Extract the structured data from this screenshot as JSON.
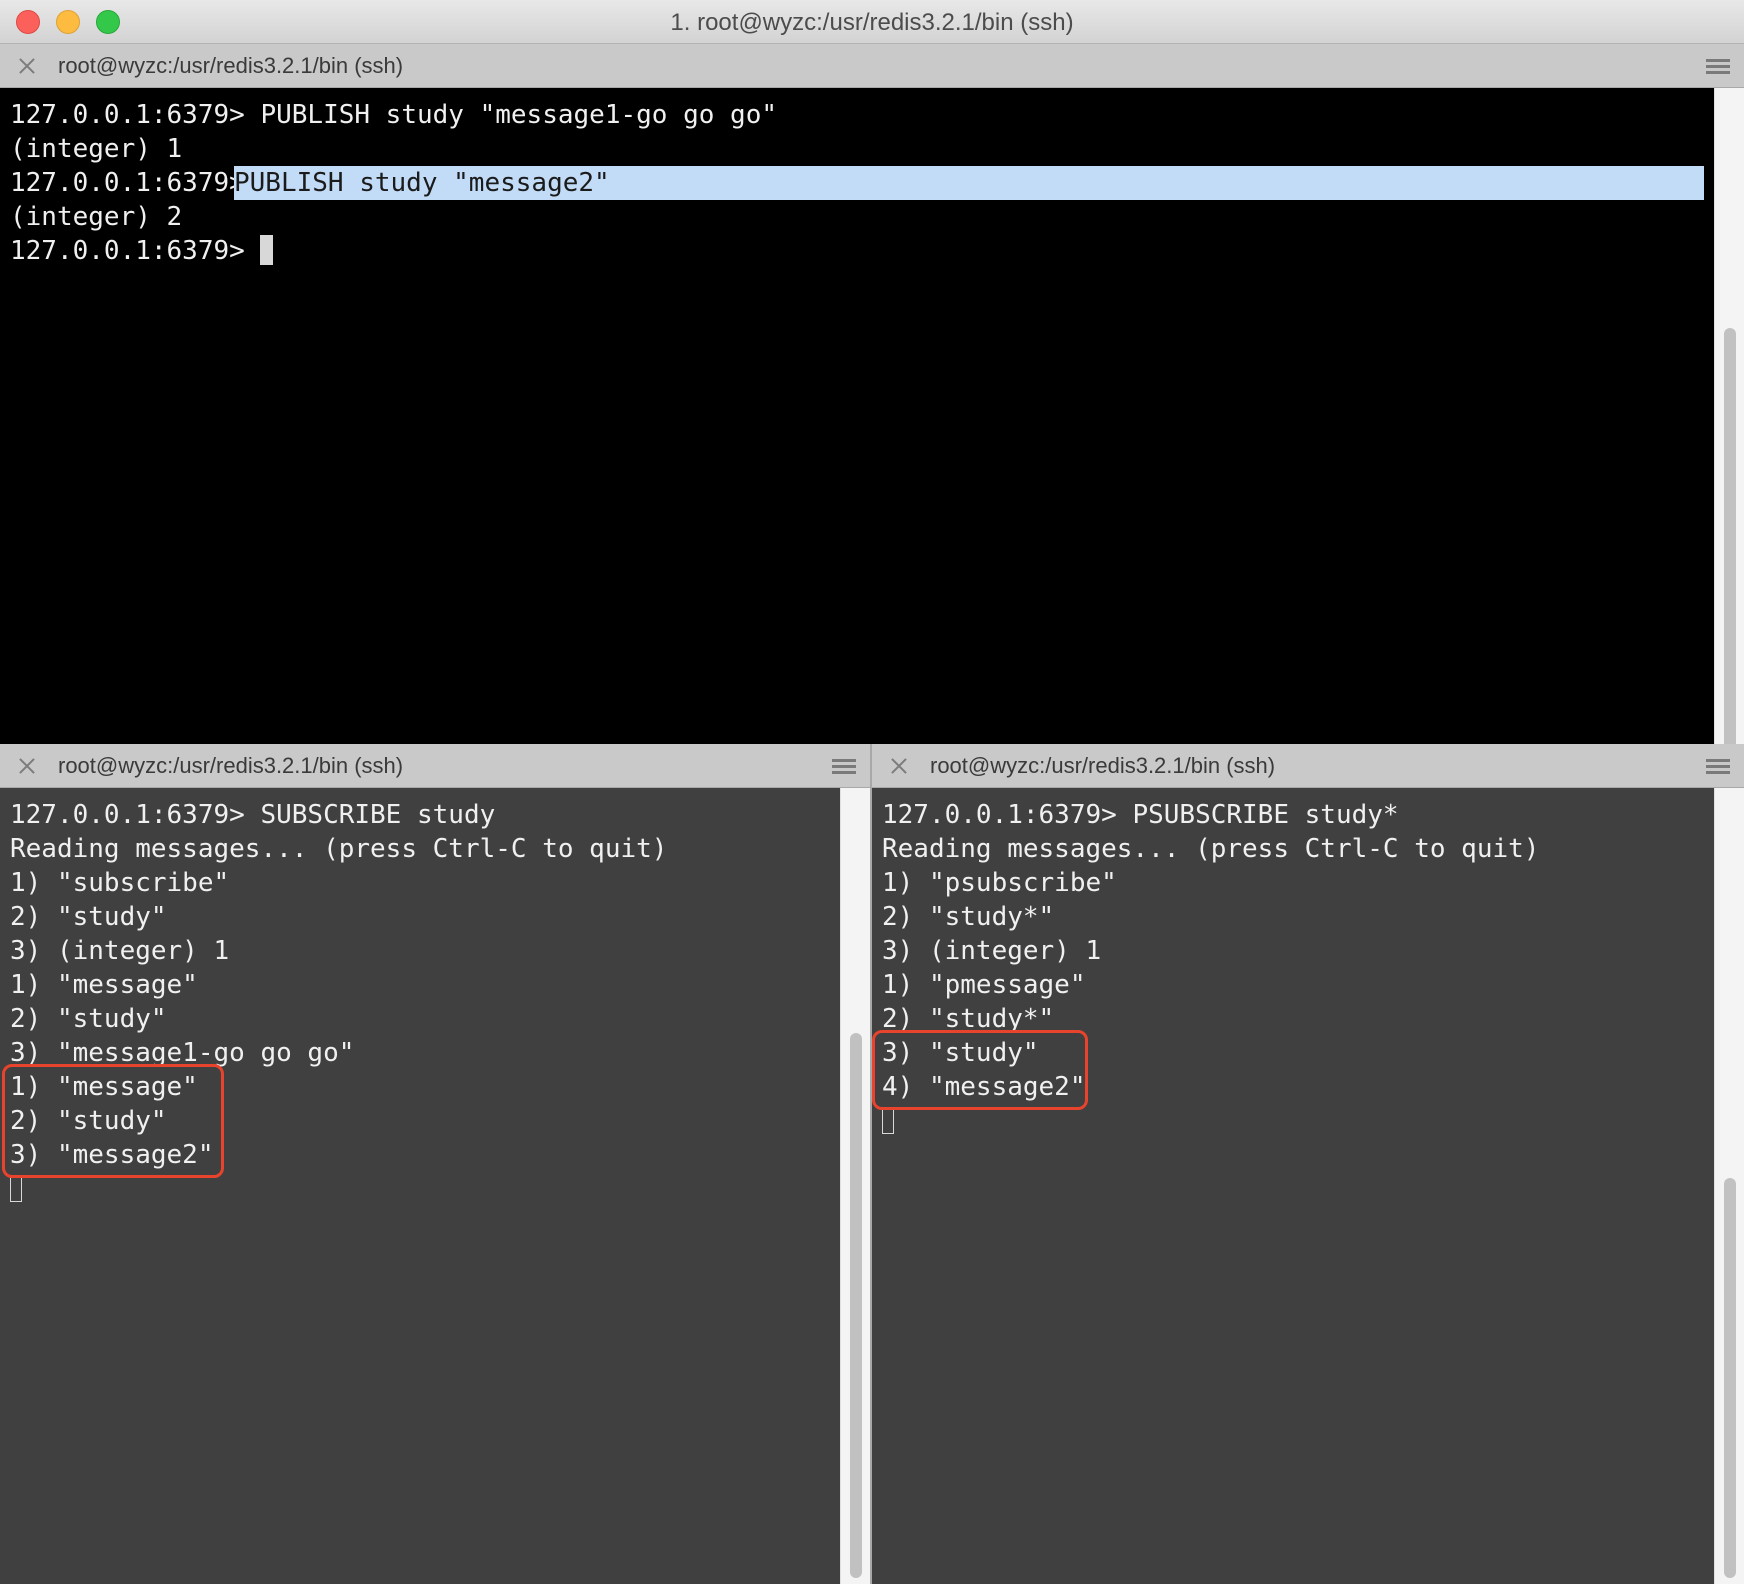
{
  "window": {
    "title": "1. root@wyzc:/usr/redis3.2.1/bin (ssh)"
  },
  "panes": {
    "top": {
      "title": "root@wyzc:/usr/redis3.2.1/bin (ssh)",
      "lines": [
        {
          "prompt": "127.0.0.1:6379> ",
          "text": "PUBLISH study \"message1-go go go\""
        },
        {
          "prompt": "",
          "text": "(integer) 1"
        },
        {
          "prompt": "127.0.0.1:6379> ",
          "text": "PUBLISH study \"message2\""
        },
        {
          "prompt": "",
          "text": "(integer) 2"
        },
        {
          "prompt": "127.0.0.1:6379> ",
          "text": ""
        }
      ]
    },
    "bottom_left": {
      "title": "root@wyzc:/usr/redis3.2.1/bin (ssh)",
      "lines": [
        "127.0.0.1:6379> SUBSCRIBE study",
        "Reading messages... (press Ctrl-C to quit)",
        "1) \"subscribe\"",
        "2) \"study\"",
        "3) (integer) 1",
        "1) \"message\"",
        "2) \"study\"",
        "3) \"message1-go go go\"",
        "1) \"message\"",
        "2) \"study\"",
        "3) \"message2\""
      ]
    },
    "bottom_right": {
      "title": "root@wyzc:/usr/redis3.2.1/bin (ssh)",
      "lines": [
        "127.0.0.1:6379> PSUBSCRIBE study*",
        "Reading messages... (press Ctrl-C to quit)",
        "1) \"psubscribe\"",
        "2) \"study*\"",
        "3) (integer) 1",
        "1) \"pmessage\"",
        "2) \"study*\"",
        "3) \"study\"",
        "4) \"message2\""
      ]
    }
  },
  "colors": {
    "highlight_box": "#e8432c",
    "selection": "#c2dbf7",
    "top_terminal_bg": "#000000",
    "bottom_terminal_bg": "#404040"
  }
}
